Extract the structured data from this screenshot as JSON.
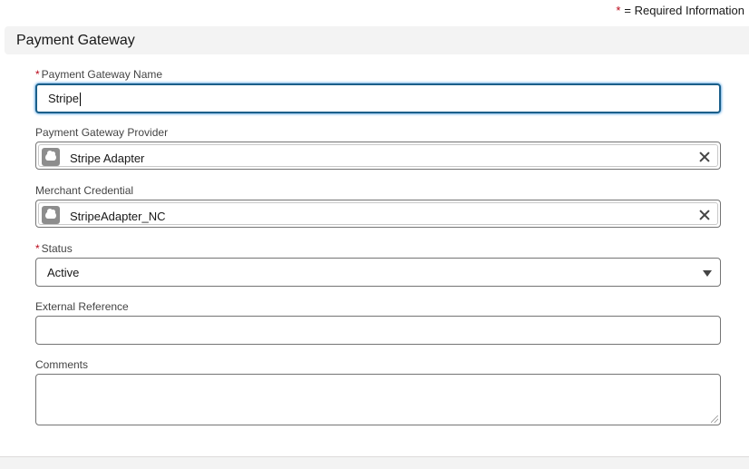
{
  "required_legend": {
    "star": "*",
    "text": "= Required Information"
  },
  "section": {
    "title": "Payment Gateway"
  },
  "fields": {
    "gateway_name": {
      "required": "*",
      "label": "Payment Gateway Name",
      "value": "Stripe"
    },
    "gateway_provider": {
      "label": "Payment Gateway Provider",
      "value": "Stripe Adapter",
      "icon": "salesforce-cloud-icon"
    },
    "merchant_credential": {
      "label": "Merchant Credential",
      "value": "StripeAdapter_NC",
      "icon": "salesforce-cloud-icon"
    },
    "status": {
      "required": "*",
      "label": "Status",
      "value": "Active"
    },
    "external_reference": {
      "label": "External Reference",
      "value": ""
    },
    "comments": {
      "label": "Comments",
      "value": ""
    }
  },
  "colors": {
    "required_star": "#ba0517",
    "focus_border": "#1b5f8a",
    "section_bg": "#f3f3f3"
  }
}
